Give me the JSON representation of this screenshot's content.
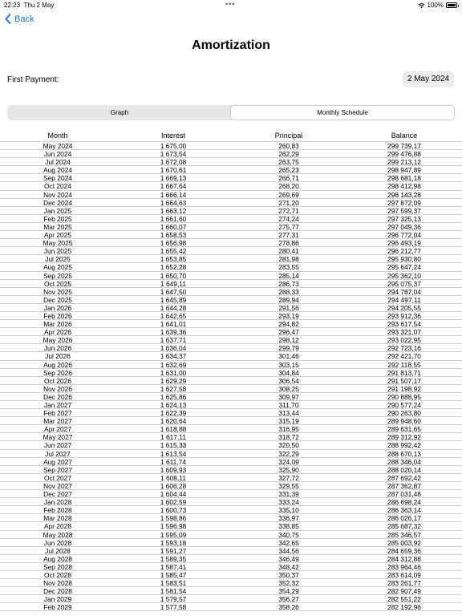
{
  "status": {
    "time": "22:23",
    "date": "Thu 2 May",
    "battery": "100%"
  },
  "nav": {
    "back_label": "Back",
    "title": "Amortization"
  },
  "first_payment": {
    "label": "First Payment:",
    "value": "2 May 2024"
  },
  "tabs": [
    {
      "label": "Graph",
      "active": false
    },
    {
      "label": "Monthly Schedule",
      "active": true
    }
  ],
  "table": {
    "headers": [
      "Month",
      "Interest",
      "Principal",
      "Balance"
    ],
    "rows": [
      [
        "May 2024",
        "1 675,00",
        "260,83",
        "299 739,17"
      ],
      [
        "Jun 2024",
        "1 673,54",
        "262,29",
        "299 476,88"
      ],
      [
        "Jul 2024",
        "1 672,08",
        "263,75",
        "299 213,12"
      ],
      [
        "Aug 2024",
        "1 670,61",
        "265,23",
        "298 947,89"
      ],
      [
        "Sep 2024",
        "1 669,13",
        "266,71",
        "298 681,18"
      ],
      [
        "Oct 2024",
        "1 667,64",
        "268,20",
        "298 412,98"
      ],
      [
        "Nov 2024",
        "1 666,14",
        "269,69",
        "298 143,28"
      ],
      [
        "Dec 2024",
        "1 664,63",
        "271,20",
        "297 872,09"
      ],
      [
        "Jan 2025",
        "1 663,12",
        "272,71",
        "297 599,37"
      ],
      [
        "Feb 2025",
        "1 661,60",
        "274,24",
        "297 325,13"
      ],
      [
        "Mar 2025",
        "1 660,07",
        "275,77",
        "297 049,36"
      ],
      [
        "Apr 2025",
        "1 658,53",
        "277,31",
        "296 772,04"
      ],
      [
        "May 2025",
        "1 656,98",
        "278,86",
        "296 493,19"
      ],
      [
        "Jun 2025",
        "1 655,42",
        "280,41",
        "296 212,77"
      ],
      [
        "Jul 2025",
        "1 653,85",
        "281,98",
        "295 930,80"
      ],
      [
        "Aug 2025",
        "1 652,28",
        "283,55",
        "295 647,24"
      ],
      [
        "Sep 2025",
        "1 650,70",
        "285,14",
        "295 362,10"
      ],
      [
        "Oct 2025",
        "1 649,11",
        "286,73",
        "295 075,37"
      ],
      [
        "Nov 2025",
        "1 647,50",
        "288,33",
        "294 787,04"
      ],
      [
        "Dec 2025",
        "1 645,89",
        "289,94",
        "294 497,11"
      ],
      [
        "Jan 2026",
        "1 644,28",
        "291,56",
        "294 205,55"
      ],
      [
        "Feb 2026",
        "1 642,65",
        "293,19",
        "293 912,36"
      ],
      [
        "Mar 2026",
        "1 641,01",
        "294,82",
        "293 617,54"
      ],
      [
        "Apr 2026",
        "1 639,36",
        "296,47",
        "293 321,07"
      ],
      [
        "May 2026",
        "1 637,71",
        "298,12",
        "293 022,95"
      ],
      [
        "Jun 2026",
        "1 636,04",
        "299,79",
        "292 723,16"
      ],
      [
        "Jul 2026",
        "1 634,37",
        "301,46",
        "292 421,70"
      ],
      [
        "Aug 2026",
        "1 632,69",
        "303,15",
        "292 118,55"
      ],
      [
        "Sep 2026",
        "1 631,00",
        "304,84",
        "291 813,71"
      ],
      [
        "Oct 2026",
        "1 629,29",
        "306,54",
        "291 507,17"
      ],
      [
        "Nov 2026",
        "1 627,58",
        "308,25",
        "291 198,92"
      ],
      [
        "Dec 2026",
        "1 625,86",
        "309,97",
        "290 888,95"
      ],
      [
        "Jan 2027",
        "1 624,13",
        "311,70",
        "290 577,24"
      ],
      [
        "Feb 2027",
        "1 622,39",
        "313,44",
        "290 263,80"
      ],
      [
        "Mar 2027",
        "1 620,64",
        "315,19",
        "289 948,60"
      ],
      [
        "Apr 2027",
        "1 618,88",
        "316,95",
        "289 631,65"
      ],
      [
        "May 2027",
        "1 617,11",
        "318,72",
        "289 312,92"
      ],
      [
        "Jun 2027",
        "1 615,33",
        "320,50",
        "288 992,42"
      ],
      [
        "Jul 2027",
        "1 613,54",
        "322,29",
        "288 670,13"
      ],
      [
        "Aug 2027",
        "1 611,74",
        "324,09",
        "288 346,04"
      ],
      [
        "Sep 2027",
        "1 609,93",
        "325,90",
        "288 020,14"
      ],
      [
        "Oct 2027",
        "1 608,11",
        "327,72",
        "287 692,42"
      ],
      [
        "Nov 2027",
        "1 606,28",
        "329,55",
        "287 362,87"
      ],
      [
        "Dec 2027",
        "1 604,44",
        "331,39",
        "287 031,48"
      ],
      [
        "Jan 2028",
        "1 602,59",
        "333,24",
        "286 698,24"
      ],
      [
        "Feb 2028",
        "1 600,73",
        "335,10",
        "286 363,14"
      ],
      [
        "Mar 2028",
        "1 598,86",
        "336,97",
        "286 026,17"
      ],
      [
        "Apr 2028",
        "1 596,98",
        "338,85",
        "285 687,32"
      ],
      [
        "May 2028",
        "1 595,09",
        "340,75",
        "285 346,57"
      ],
      [
        "Jun 2028",
        "1 593,18",
        "342,65",
        "285 003,92"
      ],
      [
        "Jul 2028",
        "1 591,27",
        "344,56",
        "284 659,36"
      ],
      [
        "Aug 2028",
        "1 589,35",
        "346,49",
        "284 312,88"
      ],
      [
        "Sep 2028",
        "1 587,41",
        "348,42",
        "283 964,46"
      ],
      [
        "Oct 2028",
        "1 585,47",
        "350,37",
        "283 614,09"
      ],
      [
        "Nov 2028",
        "1 583,51",
        "352,32",
        "283 261,77"
      ],
      [
        "Dec 2028",
        "1 581,54",
        "354,29",
        "282 907,49"
      ],
      [
        "Jan 2029",
        "1 579,57",
        "356,27",
        "282 551,22"
      ],
      [
        "Feb 2029",
        "1 577,58",
        "358,26",
        "282 192,96"
      ]
    ]
  },
  "colors": {
    "accent": "#1a73e8",
    "segment_bg": "#e6e6e9",
    "date_pill_bg": "#ececee",
    "row_divider": "#cfcfd4"
  }
}
